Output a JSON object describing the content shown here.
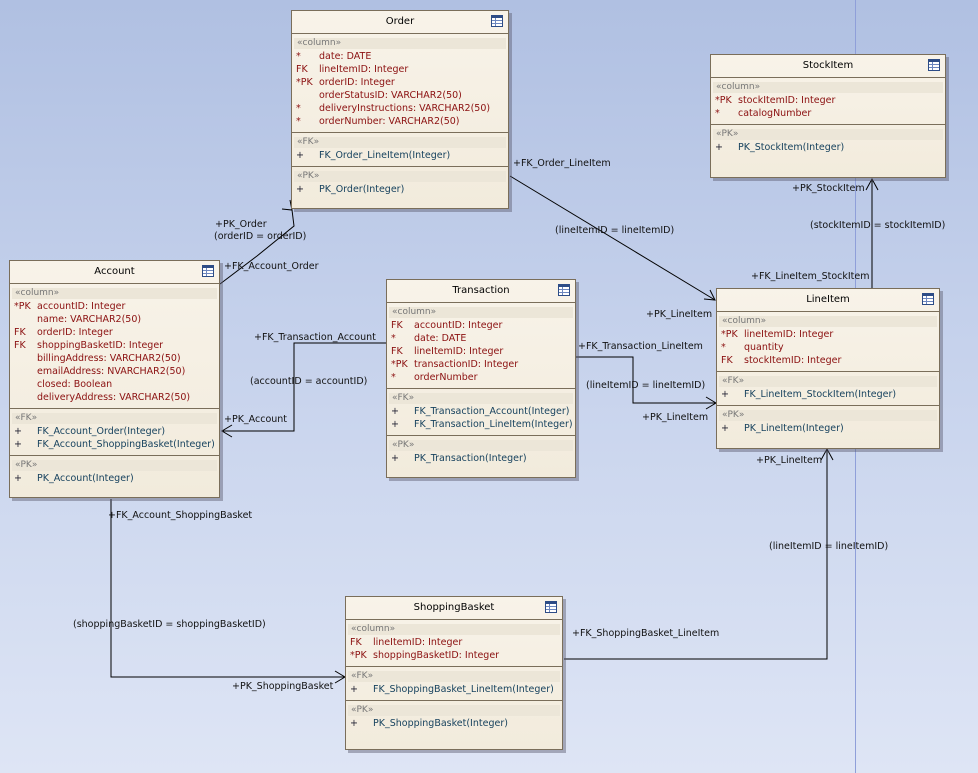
{
  "entities": {
    "order": {
      "name": "Order",
      "sections": [
        {
          "stereo": "«column»",
          "items": [
            {
              "mk": "*",
              "text": "date:  DATE"
            },
            {
              "mk": "FK",
              "text": "lineItemID:  Integer"
            },
            {
              "mk": "*PK",
              "text": "orderID:  Integer"
            },
            {
              "mk": "",
              "text": "orderStatusID:  VARCHAR2(50)"
            },
            {
              "mk": "*",
              "text": "deliveryInstructions:  VARCHAR2(50)"
            },
            {
              "mk": "*",
              "text": "orderNumber:  VARCHAR2(50)"
            }
          ]
        },
        {
          "stereo": "«FK»",
          "items": [
            {
              "mk": "+",
              "text": "FK_Order_LineItem(Integer)"
            }
          ]
        },
        {
          "stereo": "«PK»",
          "items": [
            {
              "mk": "+",
              "text": "PK_Order(Integer)"
            }
          ]
        }
      ]
    },
    "stockitem": {
      "name": "StockItem",
      "sections": [
        {
          "stereo": "«column»",
          "items": [
            {
              "mk": "*PK",
              "text": "stockItemID:  Integer"
            },
            {
              "mk": "*",
              "text": "catalogNumber"
            }
          ]
        },
        {
          "stereo": "«PK»",
          "items": [
            {
              "mk": "+",
              "text": "PK_StockItem(Integer)"
            }
          ]
        }
      ]
    },
    "account": {
      "name": "Account",
      "sections": [
        {
          "stereo": "«column»",
          "items": [
            {
              "mk": "*PK",
              "text": "accountID:  Integer"
            },
            {
              "mk": "",
              "text": "name:  VARCHAR2(50)"
            },
            {
              "mk": "FK",
              "text": "orderID:  Integer"
            },
            {
              "mk": "FK",
              "text": "shoppingBasketID:  Integer"
            },
            {
              "mk": "",
              "text": "billingAddress:  VARCHAR2(50)"
            },
            {
              "mk": "",
              "text": "emailAddress:  NVARCHAR2(50)"
            },
            {
              "mk": "",
              "text": "closed:  Boolean"
            },
            {
              "mk": "",
              "text": "deliveryAddress:  VARCHAR2(50)"
            }
          ]
        },
        {
          "stereo": "«FK»",
          "items": [
            {
              "mk": "+",
              "text": "FK_Account_Order(Integer)"
            },
            {
              "mk": "+",
              "text": "FK_Account_ShoppingBasket(Integer)"
            }
          ]
        },
        {
          "stereo": "«PK»",
          "items": [
            {
              "mk": "+",
              "text": "PK_Account(Integer)"
            }
          ]
        }
      ]
    },
    "transaction": {
      "name": "Transaction",
      "sections": [
        {
          "stereo": "«column»",
          "items": [
            {
              "mk": "FK",
              "text": "accountID:  Integer"
            },
            {
              "mk": "*",
              "text": "date:  DATE"
            },
            {
              "mk": "FK",
              "text": "lineItemID:  Integer"
            },
            {
              "mk": "*PK",
              "text": "transactionID:  Integer"
            },
            {
              "mk": "*",
              "text": "orderNumber"
            }
          ]
        },
        {
          "stereo": "«FK»",
          "items": [
            {
              "mk": "+",
              "text": "FK_Transaction_Account(Integer)"
            },
            {
              "mk": "+",
              "text": "FK_Transaction_LineItem(Integer)"
            }
          ]
        },
        {
          "stereo": "«PK»",
          "items": [
            {
              "mk": "+",
              "text": "PK_Transaction(Integer)"
            }
          ]
        }
      ]
    },
    "lineitem": {
      "name": "LineItem",
      "sections": [
        {
          "stereo": "«column»",
          "items": [
            {
              "mk": "*PK",
              "text": "lineItemID:  Integer"
            },
            {
              "mk": "*",
              "text": "quantity"
            },
            {
              "mk": "FK",
              "text": "stockItemID:  Integer"
            }
          ]
        },
        {
          "stereo": "«FK»",
          "items": [
            {
              "mk": "+",
              "text": "FK_LineItem_StockItem(Integer)"
            }
          ]
        },
        {
          "stereo": "«PK»",
          "items": [
            {
              "mk": "+",
              "text": "PK_LineItem(Integer)"
            }
          ]
        }
      ]
    },
    "shoppingbasket": {
      "name": "ShoppingBasket",
      "sections": [
        {
          "stereo": "«column»",
          "items": [
            {
              "mk": "FK",
              "text": "lineItemID:  Integer"
            },
            {
              "mk": "*PK",
              "text": "shoppingBasketID:  Integer"
            }
          ]
        },
        {
          "stereo": "«FK»",
          "items": [
            {
              "mk": "+",
              "text": "FK_ShoppingBasket_LineItem(Integer)"
            }
          ]
        },
        {
          "stereo": "«PK»",
          "items": [
            {
              "mk": "+",
              "text": "PK_ShoppingBasket(Integer)"
            }
          ]
        }
      ]
    }
  },
  "connector_labels": {
    "pk_order": "+PK_Order",
    "order_join": "(orderID = orderID)",
    "fk_account_order": "+FK_Account_Order",
    "fk_order_lineitem": "+FK_Order_LineItem",
    "order_lineitem_join": "(lineItemID = lineItemID)",
    "pk_lineitem_1": "+PK_LineItem",
    "pk_stockitem": "+PK_StockItem",
    "stock_join": "(stockItemID = stockItemID)",
    "fk_lineitem_stockitem": "+FK_LineItem_StockItem",
    "fk_transaction_account": "+FK_Transaction_Account",
    "account_join": "(accountID = accountID)",
    "pk_account": "+PK_Account",
    "fk_transaction_lineitem": "+FK_Transaction_LineItem",
    "transaction_lineitem_join": "(lineItemID = lineItemID)",
    "pk_lineitem_2": "+PK_LineItem",
    "pk_lineitem_3": "+PK_LineItem",
    "basket_lineitem_join": "(lineItemID = lineItemID)",
    "fk_shoppingbasket_lineitem": "+FK_ShoppingBasket_LineItem",
    "fk_account_shoppingbasket": "+FK_Account_ShoppingBasket",
    "basket_join": "(shoppingBasketID = shoppingBasketID)",
    "pk_shoppingbasket": "+PK_ShoppingBasket"
  }
}
